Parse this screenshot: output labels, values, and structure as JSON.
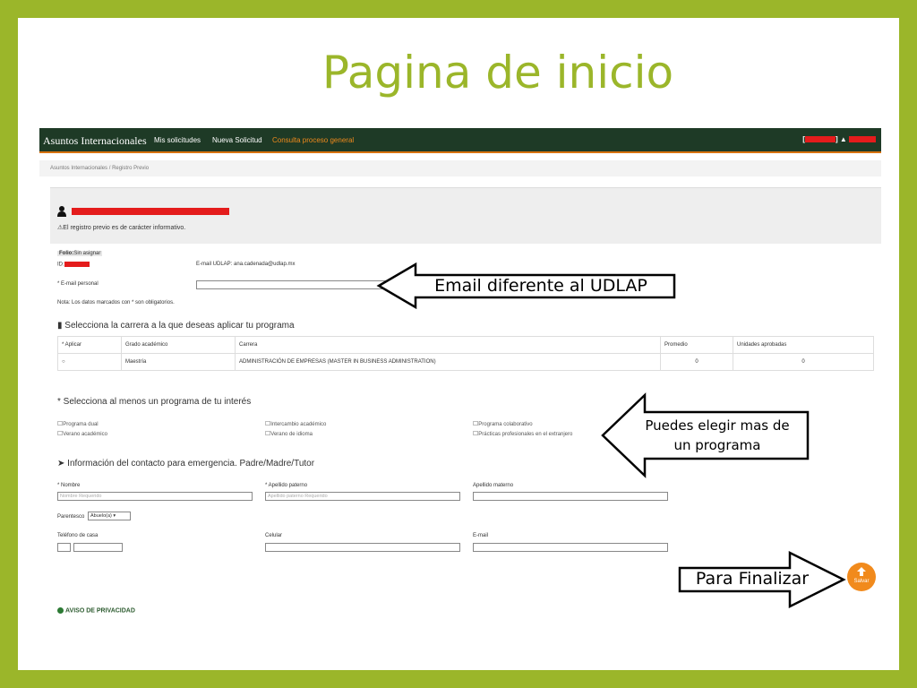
{
  "slide": {
    "title": "Pagina de inicio"
  },
  "navbar": {
    "brand": "Asuntos Internacionales",
    "links": [
      "Mis solicitudes",
      "Nueva Solicitud",
      "Consulta proceso general"
    ]
  },
  "breadcrumb": [
    "Asuntos Internacionales",
    "/",
    "Registro Previo"
  ],
  "panel": {
    "note": "El registro previo es de carácter informativo."
  },
  "folio": {
    "label": "Folio:",
    "value": "Sin asignar",
    "id_label": "ID:"
  },
  "email_udlap": {
    "label": "E-mail UDLAP:",
    "value": "ana.cadenada@udlap.mx"
  },
  "email_personal": {
    "label": "* E-mail personal"
  },
  "required_note": "Nota: Los datos marcados con * son obligatorios.",
  "career": {
    "heading": "Selecciona la carrera a la que deseas aplicar tu programa",
    "columns": [
      "* Aplicar",
      "Grado académico",
      "Carrera",
      "Promedio",
      "Unidades aprobadas"
    ],
    "rows": [
      {
        "grado": "Maestría",
        "carrera": "ADMINISTRACIÓN DE EMPRESAS (MASTER IN BUSINESS ADMINISTRATION)",
        "promedio": "0",
        "unidades": "0"
      }
    ]
  },
  "programs": {
    "heading": "* Selecciona al menos un programa de tu interés",
    "options": [
      "Programa dual",
      "Verano académico",
      "Intercambio académico",
      "Verano de idioma",
      "Programa colaborativo",
      "Prácticas profesionales en el extranjero"
    ]
  },
  "emergency": {
    "heading": "Información del contacto para emergencia. Padre/Madre/Tutor",
    "nombre_label": "* Nombre",
    "nombre_placeholder": "Nombre Requerido",
    "paterno_label": "* Apellido paterno",
    "paterno_placeholder": "Apellido paterno Requerido",
    "materno_label": "Apellido materno",
    "parentesco_label": "Parentesco",
    "parentesco_value": "Abuelo(a)",
    "telefono_label": "Teléfono de casa",
    "celular_label": "Celular",
    "email_label": "E-mail"
  },
  "privacy": "AVISO DE PRIVACIDAD",
  "save_label": "Salvar",
  "callouts": {
    "email": "Email diferente al UDLAP",
    "programs": "Puedes elegir mas de un programa",
    "finalize": "Para Finalizar"
  },
  "colors": {
    "frame": "#9bb62a",
    "navbar": "#1e3a26",
    "accent": "#f18a1c",
    "redaction": "#e41c1c"
  }
}
